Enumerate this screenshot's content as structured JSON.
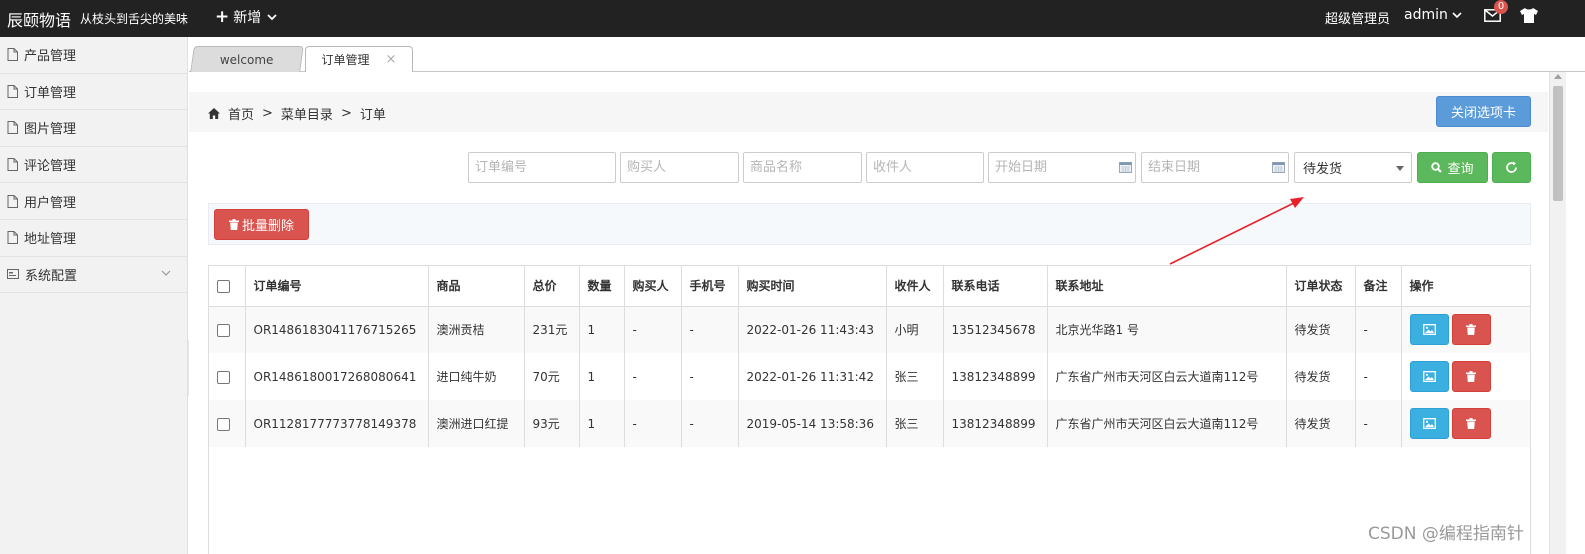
{
  "topbar": {
    "brand": "辰颐物语",
    "slogan": "从枝头到舌尖的美味",
    "add_label": "新增",
    "user_role": "超级管理员",
    "user_name": "admin",
    "mail_badge": "0"
  },
  "sidebar": {
    "items": [
      {
        "label": "产品管理"
      },
      {
        "label": "订单管理"
      },
      {
        "label": "图片管理"
      },
      {
        "label": "评论管理"
      },
      {
        "label": "用户管理"
      },
      {
        "label": "地址管理"
      },
      {
        "label": "系统配置"
      }
    ]
  },
  "tabs": [
    {
      "label": "welcome"
    },
    {
      "label": "订单管理",
      "close": "×"
    }
  ],
  "breadcrumb": {
    "home": "首页",
    "sep": ">",
    "level2": "菜单目录",
    "level3": "订单"
  },
  "close_tab_button": "关闭选项卡",
  "filters": {
    "order_no_placeholder": "订单编号",
    "buyer_placeholder": "购买人",
    "product_placeholder": "商品名称",
    "receiver_placeholder": "收件人",
    "start_date_placeholder": "开始日期",
    "end_date_placeholder": "结束日期",
    "status_selected": "待发货",
    "search_label": "查询"
  },
  "bulk_delete_label": "批量删除",
  "table": {
    "headers": [
      "订单编号",
      "商品",
      "总价",
      "数量",
      "购买人",
      "手机号",
      "购买时间",
      "收件人",
      "联系电话",
      "联系地址",
      "订单状态",
      "备注",
      "操作"
    ],
    "rows": [
      [
        "OR1486183041176715265",
        "澳洲贡桔",
        "231元",
        "1",
        "-",
        "-",
        "2022-01-26 11:43:43",
        "小明",
        "13512345678",
        "北京光华路1 号",
        "待发货",
        "-"
      ],
      [
        "OR1486180017268080641",
        "进口纯牛奶",
        "70元",
        "1",
        "-",
        "-",
        "2022-01-26 11:31:42",
        "张三",
        "13812348899",
        "广东省广州市天河区白云大道南112号",
        "待发货",
        "-"
      ],
      [
        "OR1128177773778149378",
        "澳洲进口红提",
        "93元",
        "1",
        "-",
        "-",
        "2019-05-14 13:58:36",
        "张三",
        "13812348899",
        "广东省广州市天河区白云大道南112号",
        "待发货",
        "-"
      ]
    ]
  },
  "watermark": "CSDN @编程指南针",
  "colors": {
    "topbar": "#222222",
    "primary": "#5b9bd9",
    "success": "#5cb85c",
    "danger": "#d9534f",
    "info": "#3bafe0",
    "annotation": "#e8202a"
  }
}
